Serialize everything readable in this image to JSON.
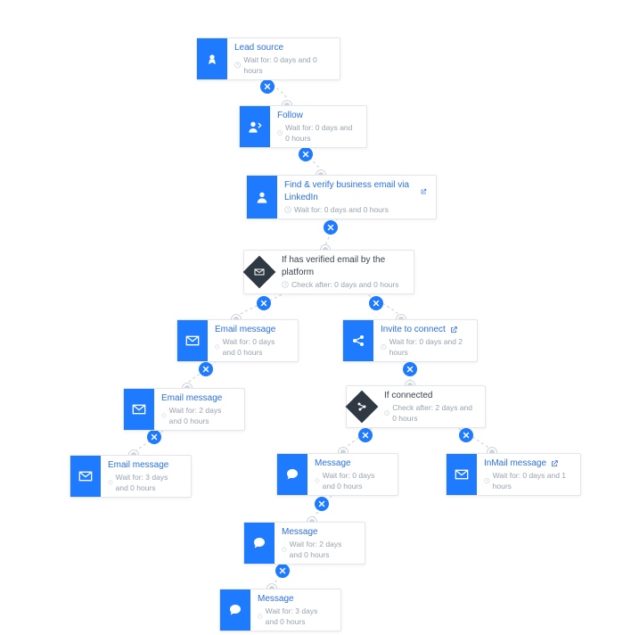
{
  "colors": {
    "accent": "#1e7bff",
    "diamond": "#2f3944",
    "green": "#34c759",
    "red": "#ff4d5e"
  },
  "diagram": {
    "nodes": [
      {
        "id": "lead",
        "title": "Lead source",
        "sub": "Wait for: 0 days and 0 hours",
        "icon": "badge",
        "kind": "action"
      },
      {
        "id": "follow",
        "title": "Follow",
        "sub": "Wait for: 0 days and 0 hours",
        "icon": "follow",
        "kind": "action"
      },
      {
        "id": "find",
        "title": "Find & verify business email via LinkedIn",
        "sub": "Wait for: 0 days and 0 hours",
        "icon": "person",
        "kind": "action",
        "external": true
      },
      {
        "id": "cond1",
        "title": "If has verified email by the platform",
        "sub": "Check after: 0 days and 0 hours",
        "icon": "envelope",
        "kind": "condition"
      },
      {
        "id": "email1",
        "title": "Email message",
        "sub": "Wait for: 0 days and 0 hours",
        "icon": "envelope",
        "kind": "action"
      },
      {
        "id": "email2",
        "title": "Email message",
        "sub": "Wait for: 2 days and 0 hours",
        "icon": "envelope",
        "kind": "action"
      },
      {
        "id": "email3",
        "title": "Email message",
        "sub": "Wait for: 3 days and 0 hours",
        "icon": "envelope",
        "kind": "action"
      },
      {
        "id": "invite",
        "title": "Invite to connect",
        "sub": "Wait for: 0 days and 2 hours",
        "icon": "share",
        "kind": "action",
        "external": true
      },
      {
        "id": "cond2",
        "title": "If connected",
        "sub": "Check after: 2 days and 0 hours",
        "icon": "nodes",
        "kind": "condition"
      },
      {
        "id": "msg1",
        "title": "Message",
        "sub": "Wait for: 0 days and 0 hours",
        "icon": "chat",
        "kind": "action"
      },
      {
        "id": "msg2",
        "title": "Message",
        "sub": "Wait for: 2 days and 0 hours",
        "icon": "chat",
        "kind": "action"
      },
      {
        "id": "msg3",
        "title": "Message",
        "sub": "Wait for: 3 days and 0 hours",
        "icon": "chat",
        "kind": "action"
      },
      {
        "id": "inmail",
        "title": "InMail message",
        "sub": "Wait for: 0 days and 1 hours",
        "icon": "envelope",
        "kind": "action",
        "external": true
      }
    ]
  }
}
